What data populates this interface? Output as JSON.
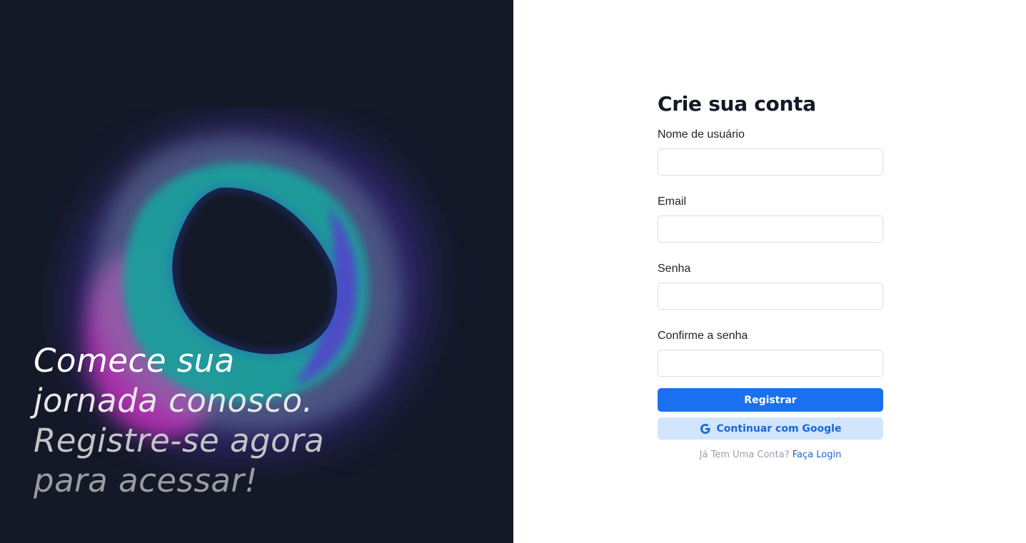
{
  "hero": {
    "line1": "Comece sua",
    "line2": "jornada conosco.",
    "line3": "Registre-se agora",
    "line4": "para acessar!"
  },
  "form": {
    "title": "Crie sua conta",
    "fields": [
      {
        "label": "Nome de usuário",
        "value": "",
        "placeholder": ""
      },
      {
        "label": "Email",
        "value": "",
        "placeholder": ""
      },
      {
        "label": "Senha",
        "value": "",
        "placeholder": ""
      },
      {
        "label": "Confirme a senha",
        "value": "",
        "placeholder": ""
      }
    ],
    "register_label": "Registrar",
    "google_label": "Continuar com Google",
    "have_account_text": "Já Tem Uma Conta?",
    "login_link": "Faça Login"
  },
  "colors": {
    "hero_background": "#141927",
    "primary": "#1a70f0",
    "google_button_bg": "#d1e5fc",
    "link": "#1a67d6",
    "blob_teal": "#1a9e9c",
    "blob_magenta": "#c232b8",
    "blob_purple": "#4b2fb0"
  },
  "icons": {
    "google": "google-icon"
  }
}
